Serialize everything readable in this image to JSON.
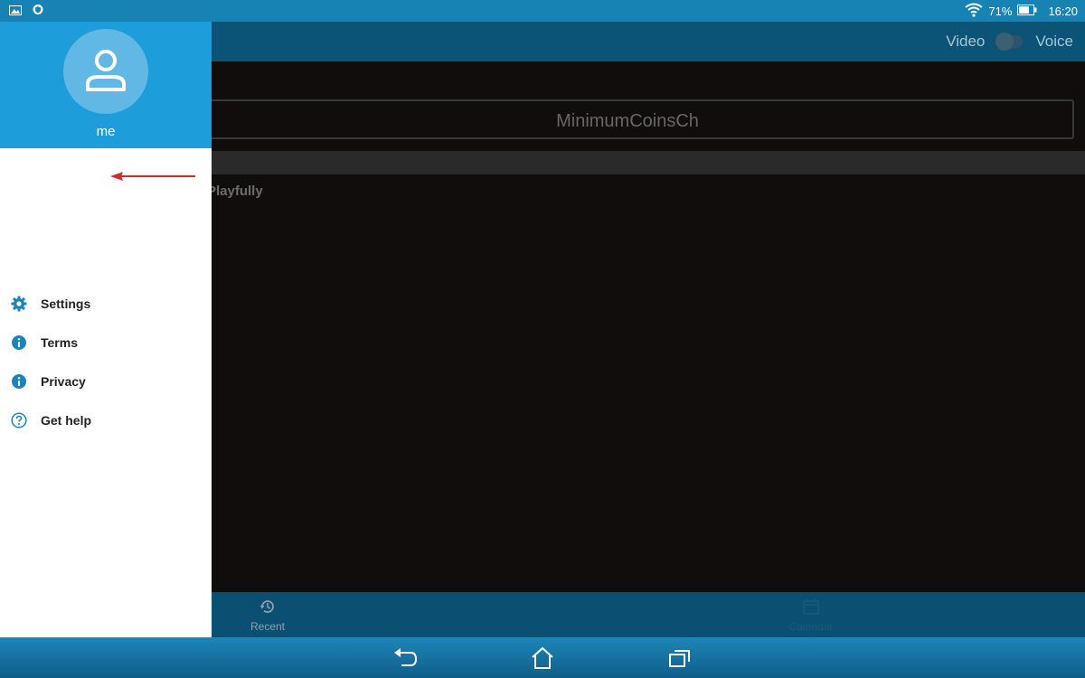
{
  "status_bar": {
    "battery_percent": "71%",
    "time": "16:20",
    "left_icons": [
      "image-icon",
      "shield-icon"
    ],
    "right_icons": [
      "wifi-icon",
      "battery-icon"
    ]
  },
  "app_bar": {
    "video_label": "Video",
    "voice_label": "Voice",
    "toggle_state": "off"
  },
  "main": {
    "input_value": "MinimumCoinsCh",
    "partial_text": "Playfully"
  },
  "bottom_nav": {
    "tabs": [
      {
        "label": "Recent",
        "icon": "history-icon"
      },
      {
        "label": "Calendar",
        "icon": "calendar-icon"
      }
    ]
  },
  "drawer": {
    "username": "me",
    "avatar_icon": "person-icon",
    "items": [
      {
        "label": "Settings",
        "icon": "gear-icon"
      },
      {
        "label": "Terms",
        "icon": "info-icon"
      },
      {
        "label": "Privacy",
        "icon": "info-icon"
      },
      {
        "label": "Get help",
        "icon": "help-icon"
      }
    ]
  },
  "annotation": {
    "type": "red-arrow",
    "points_to": "Settings"
  },
  "system_nav": {
    "buttons": [
      "back-icon",
      "home-icon",
      "recents-icon"
    ]
  },
  "colors": {
    "status_bar": "#1782b4",
    "app_bar": "#0b5478",
    "drawer_header": "#1e9ddb",
    "accent_icon": "#1a86b8",
    "annotation_arrow": "#d32a2a"
  }
}
